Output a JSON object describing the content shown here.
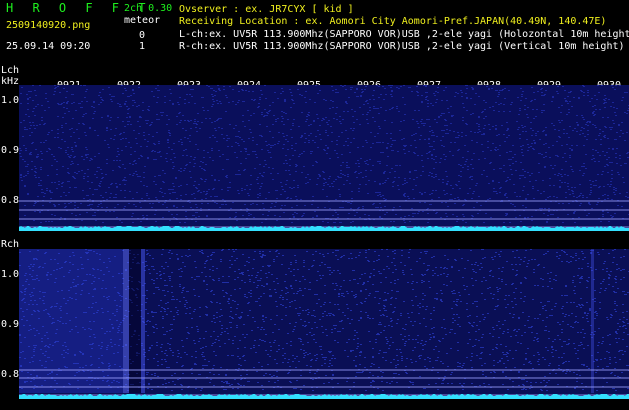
{
  "header": {
    "title": "H R O F F T",
    "mode": "2ch 0.30",
    "filename": "2509140920.png",
    "meteor_label": "meteor",
    "meteor_l": "0",
    "meteor_r": "1",
    "datetime": "25.09.14 09:20"
  },
  "info": {
    "observer": "Ovserver           : ex. JR7CYX [ kid ]",
    "location": "Receiving Location : ex. Aomori City Aomori-Pref.JAPAN(40.49N, 140.47E)",
    "lch": "L-ch:ex. UV5R 113.900Mhz(SAPPORO VOR)USB ,2-ele yagi (Holozontal 10m height)",
    "rch": "R-ch:ex. UV5R 113.900Mhz(SAPPORO VOR)USB ,2-ele yagi (Vertical 10m height)"
  },
  "channels": {
    "lch_label": "Lch",
    "unit_label": "kHz",
    "rch_label": "Rch"
  },
  "time_ticks": [
    "0921",
    "0922",
    "0923",
    "0924",
    "0925",
    "0926",
    "0927",
    "0928",
    "0929",
    "0930"
  ],
  "freq_ticks": [
    "1.0",
    "0.9",
    "0.8"
  ],
  "colors": {
    "background": "#000000",
    "spectrum_base": "#0a0f55",
    "spectrum_noise": "#2a3cc8",
    "baseline": "#33e0ff",
    "header_green": "#1ef01e",
    "header_yellow": "#f0f01e"
  }
}
